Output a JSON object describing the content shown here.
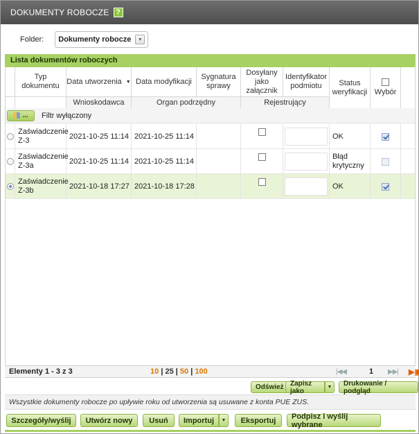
{
  "window": {
    "title": "DOKUMENTY ROBOCZE",
    "help_label": "?"
  },
  "folder": {
    "label": "Folder:",
    "value": "Dokumenty robocze"
  },
  "panel": {
    "title": "Lista dokumentów roboczych"
  },
  "columns": {
    "type": "Typ dokumentu",
    "created": "Data utworzenia",
    "modified": "Data modyfikacji",
    "signature": "Sygnatura sprawy",
    "attachment": "Dosyłany jako załącznik",
    "subject_id": "Identyfikator podmiotu",
    "status": "Status weryfikacji",
    "select": "Wybór"
  },
  "subcolumns": {
    "applicant": "Wnioskodawca",
    "subordinate": "Organ podrzędny",
    "registering": "Rejestrujący"
  },
  "filter": {
    "button_label": "...",
    "text": "Filtr wyłączony"
  },
  "rows": [
    {
      "type": "Zaświadczenie Z-3",
      "created": "2021-10-25 11:14",
      "modified": "2021-10-25 11:14",
      "signature": "",
      "attachment": false,
      "subject_id": "",
      "status": "OK",
      "selected": true,
      "radio": false
    },
    {
      "type": "Zaświadczenie Z-3a",
      "created": "2021-10-25 11:14",
      "modified": "2021-10-25 11:14",
      "signature": "",
      "attachment": false,
      "subject_id": "",
      "status": "Błąd krytyczny",
      "selected": false,
      "radio": false
    },
    {
      "type": "Zaświadczenie Z-3b",
      "created": "2021-10-18 17:27",
      "modified": "2021-10-18 17:28",
      "signature": "",
      "attachment": false,
      "subject_id": "",
      "status": "OK",
      "selected": true,
      "radio": true
    }
  ],
  "pager": {
    "count": "Elementy 1 - 3 z 3",
    "sizes": [
      "10",
      "25",
      "50",
      "100"
    ],
    "separator": "|",
    "current_page": "1",
    "first_prev": "|◀◀",
    "next_last": "▶▶|",
    "export_icon": "export-icon"
  },
  "actions": {
    "refresh": "Odśwież",
    "save_as": "Zapisz jako",
    "print": "Drukowanie / podgląd"
  },
  "notice": "Wszystkie dokumenty robocze po upływie roku od utworzenia są usuwane z konta PUE ZUS.",
  "buttons": {
    "details": "Szczegóły/wyślij",
    "create": "Utwórz nowy",
    "delete": "Usuń",
    "import": "Importuj",
    "export": "Eksportuj",
    "sign_send": "Podpisz i wyślij wybrane"
  },
  "colors": {
    "accent": "#a7d163",
    "title_bg": "#5a5a5a",
    "selected_row": "#e9f3d6",
    "pager_link": "#d97a00"
  }
}
